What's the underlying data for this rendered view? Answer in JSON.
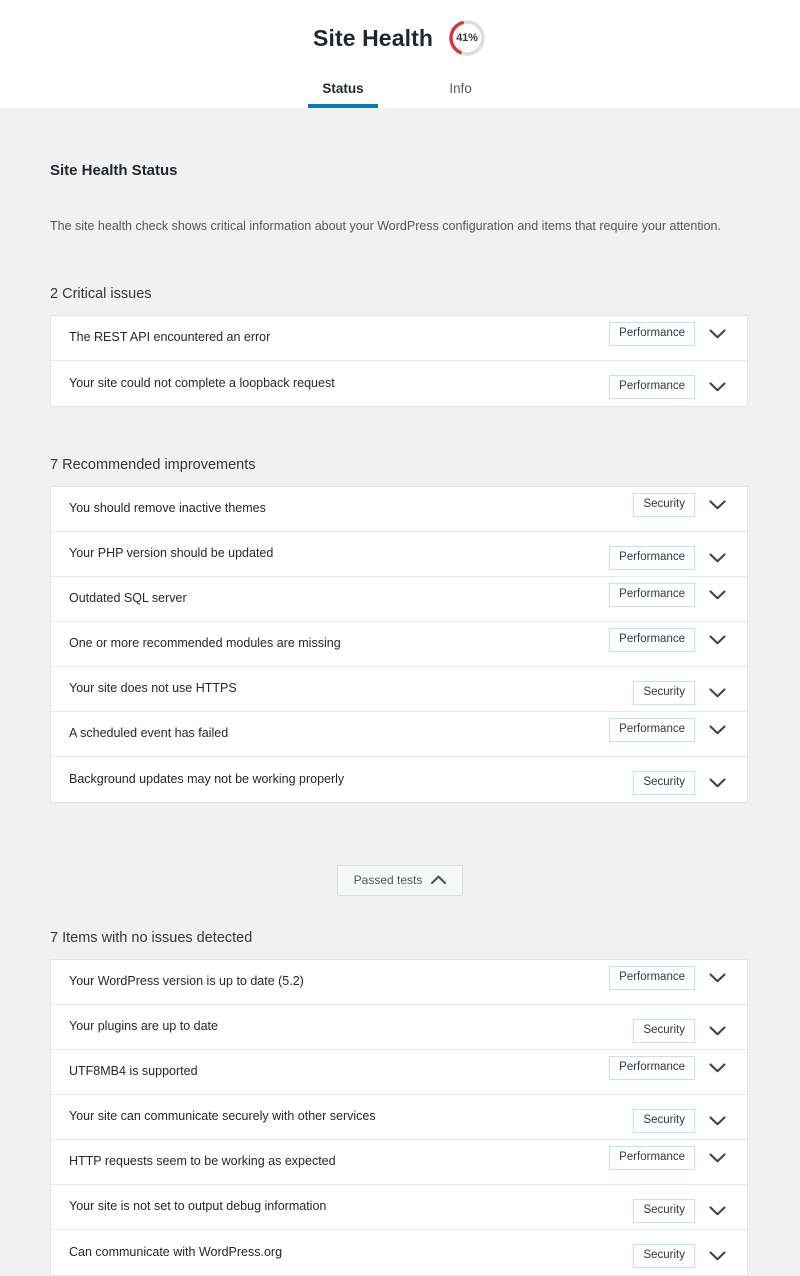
{
  "header": {
    "title": "Site Health",
    "gauge": {
      "percent_label": "41%",
      "percent_value": 41,
      "arc_color": "#d63638",
      "track_color": "#dcdcde"
    },
    "tabs": [
      {
        "label": "Status",
        "active": true
      },
      {
        "label": "Info",
        "active": false
      }
    ]
  },
  "main": {
    "section_title": "Site Health Status",
    "intro": "The site health check shows critical information about your WordPress configuration and items that require your attention.",
    "accent_color": "#007cba",
    "groups": [
      {
        "heading": "2 Critical issues",
        "rows": [
          {
            "label": "The REST API encountered an error",
            "badge": "Performance",
            "offset": "up"
          },
          {
            "label": "Your site could not complete a loopback request",
            "badge": "Performance",
            "offset": "down"
          }
        ]
      },
      {
        "heading": "7 Recommended improvements",
        "rows": [
          {
            "label": "You should remove inactive themes",
            "badge": "Security",
            "offset": "up"
          },
          {
            "label": "Your PHP version should be updated",
            "badge": "Performance",
            "offset": "down"
          },
          {
            "label": "Outdated SQL server",
            "badge": "Performance",
            "offset": "up"
          },
          {
            "label": "One or more recommended modules are missing",
            "badge": "Performance",
            "offset": "up"
          },
          {
            "label": "Your site does not use HTTPS",
            "badge": "Security",
            "offset": "down"
          },
          {
            "label": "A scheduled event has failed",
            "badge": "Performance",
            "offset": "up"
          },
          {
            "label": "Background updates may not be working properly",
            "badge": "Security",
            "offset": "down"
          }
        ]
      }
    ],
    "passed_tests_button": {
      "label": "Passed tests",
      "icon": "chevron-up-icon",
      "expanded": true
    },
    "passed_group": {
      "heading": "7 Items with no issues detected",
      "rows": [
        {
          "label": "Your WordPress version is up to date (5.2)",
          "badge": "Performance",
          "offset": "up"
        },
        {
          "label": "Your plugins are up to date",
          "badge": "Security",
          "offset": "down"
        },
        {
          "label": "UTF8MB4 is supported",
          "badge": "Performance",
          "offset": "up"
        },
        {
          "label": "Your site can communicate securely with other services",
          "badge": "Security",
          "offset": "down"
        },
        {
          "label": "HTTP requests seem to be working as expected",
          "badge": "Performance",
          "offset": "up"
        },
        {
          "label": "Your site is not set to output debug information",
          "badge": "Security",
          "offset": "down"
        },
        {
          "label": "Can communicate with WordPress.org",
          "badge": "Security",
          "offset": "down"
        }
      ]
    }
  }
}
